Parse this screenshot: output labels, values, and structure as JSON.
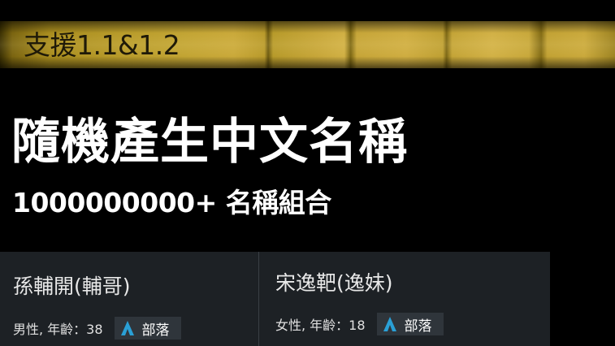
{
  "banner": {
    "text": "支援1.1&1.2"
  },
  "hero": {
    "title": "隨機產生中文名稱",
    "subtitle": "1000000000+ 名稱組合"
  },
  "cards": [
    {
      "name": "孫輔開(輔哥)",
      "meta": "男性, 年齡：38",
      "badge_label": "部落",
      "badge_icon": "horde-a-icon",
      "accent": "#2aa0d6"
    },
    {
      "name": "宋逸靶(逸妹)",
      "meta": "女性, 年齡：18",
      "badge_label": "部落",
      "badge_icon": "horde-a-icon",
      "accent": "#2aa0d6"
    }
  ]
}
